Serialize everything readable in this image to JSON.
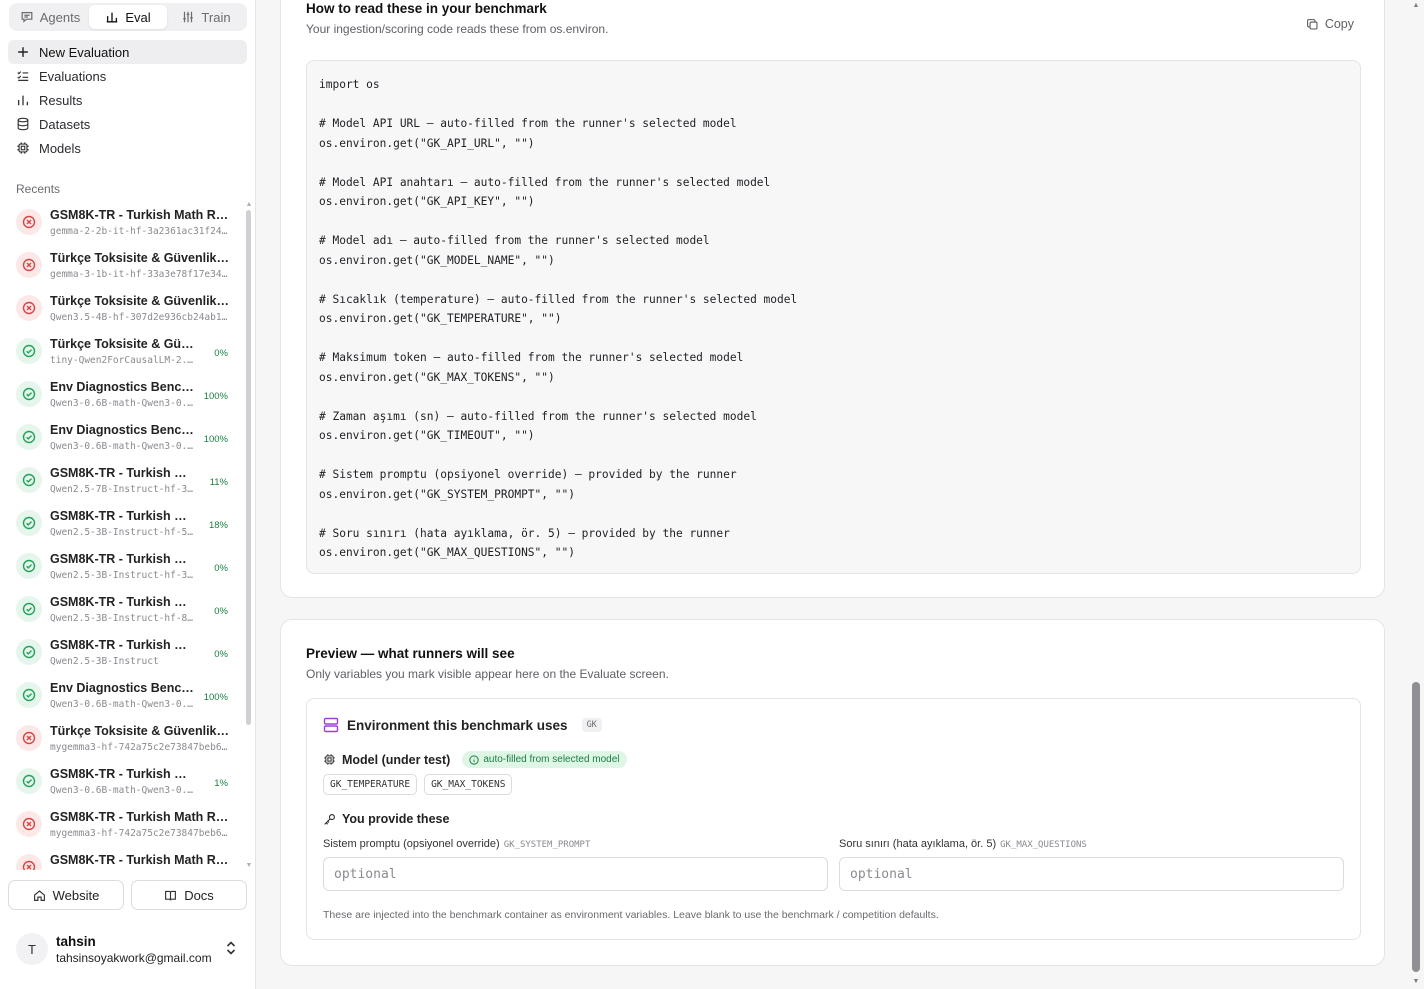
{
  "modes": [
    {
      "label": "Agents",
      "icon": "chat-icon",
      "active": false
    },
    {
      "label": "Eval",
      "icon": "chart-icon",
      "active": true
    },
    {
      "label": "Train",
      "icon": "sliders-icon",
      "active": false
    }
  ],
  "nav": [
    {
      "label": "New Evaluation",
      "icon": "plus-icon"
    },
    {
      "label": "Evaluations",
      "icon": "list-check-icon"
    },
    {
      "label": "Results",
      "icon": "bar-chart-icon"
    },
    {
      "label": "Datasets",
      "icon": "database-icon"
    },
    {
      "label": "Models",
      "icon": "cpu-icon"
    }
  ],
  "recents_title": "Recents",
  "recents": [
    {
      "title": "GSM8K-TR - Turkish Math Rea...",
      "model": "gemma-2-2b-it-hf-3a2361ac31f24b...",
      "status": "fail",
      "pct": ""
    },
    {
      "title": "Türkçe Toksisite & Güvenlik Sın...",
      "model": "gemma-3-1b-it-hf-33a3e78f17e34f...",
      "status": "fail",
      "pct": ""
    },
    {
      "title": "Türkçe Toksisite & Güvenlik Sın...",
      "model": "Qwen3.5-4B-hf-307d2e936cb24ab19...",
      "status": "fail",
      "pct": ""
    },
    {
      "title": "Türkçe Toksisite & Güvenli...",
      "model": "tiny-Qwen2ForCausalLM-2.5-...",
      "status": "ok",
      "pct": "0%"
    },
    {
      "title": "Env Diagnostics Benchm...",
      "model": "Qwen3-0.6B-math-Qwen3-0.6...",
      "status": "ok",
      "pct": "100%"
    },
    {
      "title": "Env Diagnostics Benchm...",
      "model": "Qwen3-0.6B-math-Qwen3-0.6...",
      "status": "ok",
      "pct": "100%"
    },
    {
      "title": "GSM8K-TR - Turkish Mat...",
      "model": "Qwen2.5-7B-Instruct-hf-3d4...",
      "status": "ok",
      "pct": "11%"
    },
    {
      "title": "GSM8K-TR - Turkish Mat...",
      "model": "Qwen2.5-3B-Instruct-hf-57e...",
      "status": "ok",
      "pct": "18%"
    },
    {
      "title": "GSM8K-TR - Turkish Math...",
      "model": "Qwen2.5-3B-Instruct-hf-31f...",
      "status": "ok",
      "pct": "0%"
    },
    {
      "title": "GSM8K-TR - Turkish Math...",
      "model": "Qwen2.5-3B-Instruct-hf-878...",
      "status": "ok",
      "pct": "0%"
    },
    {
      "title": "GSM8K-TR - Turkish Math...",
      "model": "Qwen2.5-3B-Instruct",
      "status": "ok",
      "pct": "0%"
    },
    {
      "title": "Env Diagnostics Benchm...",
      "model": "Qwen3-0.6B-math-Qwen3-0.6...",
      "status": "ok",
      "pct": "100%"
    },
    {
      "title": "Türkçe Toksisite & Güvenlik Sın...",
      "model": "mygemma3-hf-742a75c2e73847beb61...",
      "status": "fail",
      "pct": ""
    },
    {
      "title": "GSM8K-TR - Turkish Math ...",
      "model": "Qwen3-0.6B-math-Qwen3-0.6B_...",
      "status": "ok",
      "pct": "1%"
    },
    {
      "title": "GSM8K-TR - Turkish Math Rea...",
      "model": "mygemma3-hf-742a75c2e73847beb61...",
      "status": "fail",
      "pct": ""
    },
    {
      "title": "GSM8K-TR - Turkish Math Rea...",
      "model": "",
      "status": "fail",
      "pct": ""
    }
  ],
  "bottom": {
    "website": "Website",
    "docs": "Docs"
  },
  "user": {
    "initial": "T",
    "name": "tahsin",
    "email": "tahsinsoyakwork@gmail.com"
  },
  "read_section": {
    "title": "How to read these in your benchmark",
    "subtitle": "Your ingestion/scoring code reads these from os.environ.",
    "copy_label": "Copy",
    "code": "import os\n\n# Model API URL — auto-filled from the runner's selected model\nos.environ.get(\"GK_API_URL\", \"\")\n\n# Model API anahtarı — auto-filled from the runner's selected model\nos.environ.get(\"GK_API_KEY\", \"\")\n\n# Model adı — auto-filled from the runner's selected model\nos.environ.get(\"GK_MODEL_NAME\", \"\")\n\n# Sıcaklık (temperature) — auto-filled from the runner's selected model\nos.environ.get(\"GK_TEMPERATURE\", \"\")\n\n# Maksimum token — auto-filled from the runner's selected model\nos.environ.get(\"GK_MAX_TOKENS\", \"\")\n\n# Zaman aşımı (sn) — auto-filled from the runner's selected model\nos.environ.get(\"GK_TIMEOUT\", \"\")\n\n# Sistem promptu (opsiyonel override) — provided by the runner\nos.environ.get(\"GK_SYSTEM_PROMPT\", \"\")\n\n# Soru sınırı (hata ayıklama, ör. 5) — provided by the runner\nos.environ.get(\"GK_MAX_QUESTIONS\", \"\")"
  },
  "preview": {
    "title": "Preview — what runners will see",
    "subtitle": "Only variables you mark visible appear here on the Evaluate screen.",
    "env_title": "Environment this benchmark uses",
    "env_tag": "GK",
    "model_label": "Model (under test)",
    "auto_badge": "auto-filled from selected model",
    "chips": [
      "GK_TEMPERATURE",
      "GK_MAX_TOKENS"
    ],
    "provide_label": "You provide these",
    "fields": [
      {
        "label": "Sistem promptu (opsiyonel override)",
        "var": "GK_SYSTEM_PROMPT",
        "placeholder": "optional"
      },
      {
        "label": "Soru sınırı (hata ayıklama, ör. 5)",
        "var": "GK_MAX_QUESTIONS",
        "placeholder": "optional"
      }
    ],
    "hint": "These are injected into the benchmark container as environment variables. Leave blank to use the benchmark / competition defaults."
  },
  "colors": {
    "fail": "#d64545",
    "ok": "#22a25a",
    "accent_purple": "#9b3fd6"
  }
}
